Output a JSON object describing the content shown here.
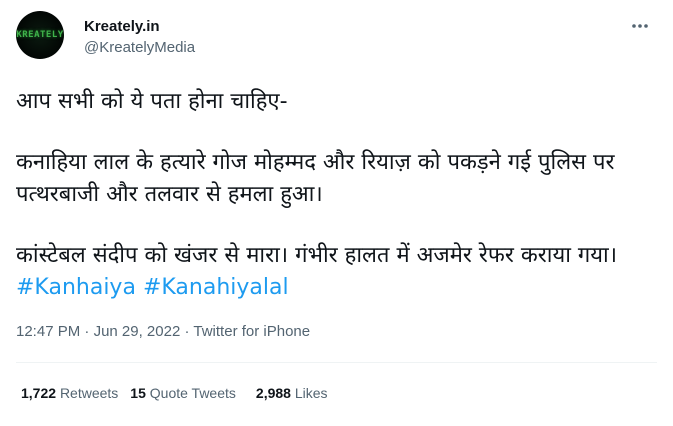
{
  "author": {
    "display_name": "Kreately.in",
    "handle": "@KreatelyMedia",
    "avatar_text": "KREATELY"
  },
  "tweet": {
    "line_intro": "आप सभी को ये पता होना चाहिए-",
    "para2": "कनाहिया लाल के हत्यारे गोज मोहम्मद और रियाज़ को पकड़ने गई पुलिस पर पत्थरबाजी और तलवार से हमला हुआ।",
    "para3_text": "कांस्टेबल संदीप को खंजर से मारा। गंभीर हालत में अजमेर रेफर कराया गया।",
    "hashtags": [
      "#Kanhaiya",
      "#Kanahiyalal"
    ]
  },
  "meta": {
    "time": "12:47 PM",
    "separator": "·",
    "date": "Jun 29, 2022",
    "source": "Twitter for iPhone"
  },
  "stats": {
    "retweets_count": "1,722",
    "retweets_label": "Retweets",
    "quotes_count": "15",
    "quotes_label": "Quote Tweets",
    "likes_count": "2,988",
    "likes_label": "Likes"
  },
  "icons": {
    "more": "more-horizontal-icon"
  },
  "colors": {
    "link": "#1d9bf0",
    "secondary_text": "#536471",
    "primary_text": "#0f1419",
    "divider": "#eff3f4"
  }
}
